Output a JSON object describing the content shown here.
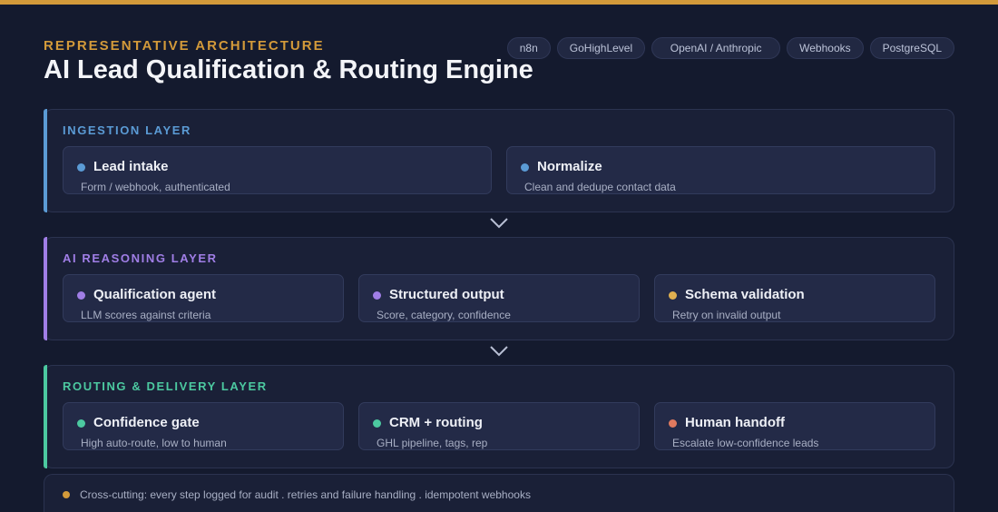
{
  "header": {
    "eyebrow": "REPRESENTATIVE ARCHITECTURE",
    "title": "AI Lead Qualification & Routing Engine",
    "tags": [
      "n8n",
      "GoHighLevel",
      "OpenAI / Anthropic",
      "Webhooks",
      "PostgreSQL"
    ]
  },
  "colors": {
    "brand": "#d39a3a",
    "ingestion": "#5b9bd5",
    "reasoning": "#a07ee6",
    "routing": "#4cc9a0",
    "warn": "#e0b050",
    "danger": "#e07a5f"
  },
  "layers": [
    {
      "title": "INGESTION LAYER",
      "cards": [
        {
          "name": "Lead intake",
          "desc": "Form / webhook, authenticated",
          "dot": "#5b9bd5"
        },
        {
          "name": "Normalize",
          "desc": "Clean and dedupe contact data",
          "dot": "#5b9bd5"
        }
      ]
    },
    {
      "title": "AI REASONING LAYER",
      "cards": [
        {
          "name": "Qualification agent",
          "desc": "LLM scores against criteria",
          "dot": "#a07ee6"
        },
        {
          "name": "Structured output",
          "desc": "Score, category, confidence",
          "dot": "#a07ee6"
        },
        {
          "name": "Schema validation",
          "desc": "Retry on invalid output",
          "dot": "#e0b050"
        }
      ]
    },
    {
      "title": "ROUTING & DELIVERY LAYER",
      "cards": [
        {
          "name": "Confidence gate",
          "desc": "High auto-route, low to human",
          "dot": "#4cc9a0"
        },
        {
          "name": "CRM + routing",
          "desc": "GHL pipeline, tags, rep",
          "dot": "#4cc9a0"
        },
        {
          "name": "Human handoff",
          "desc": "Escalate low-confidence leads",
          "dot": "#e07a5f"
        }
      ]
    }
  ],
  "footer": {
    "text": "Cross-cutting: every step logged for audit . retries and failure handling . idempotent webhooks"
  }
}
